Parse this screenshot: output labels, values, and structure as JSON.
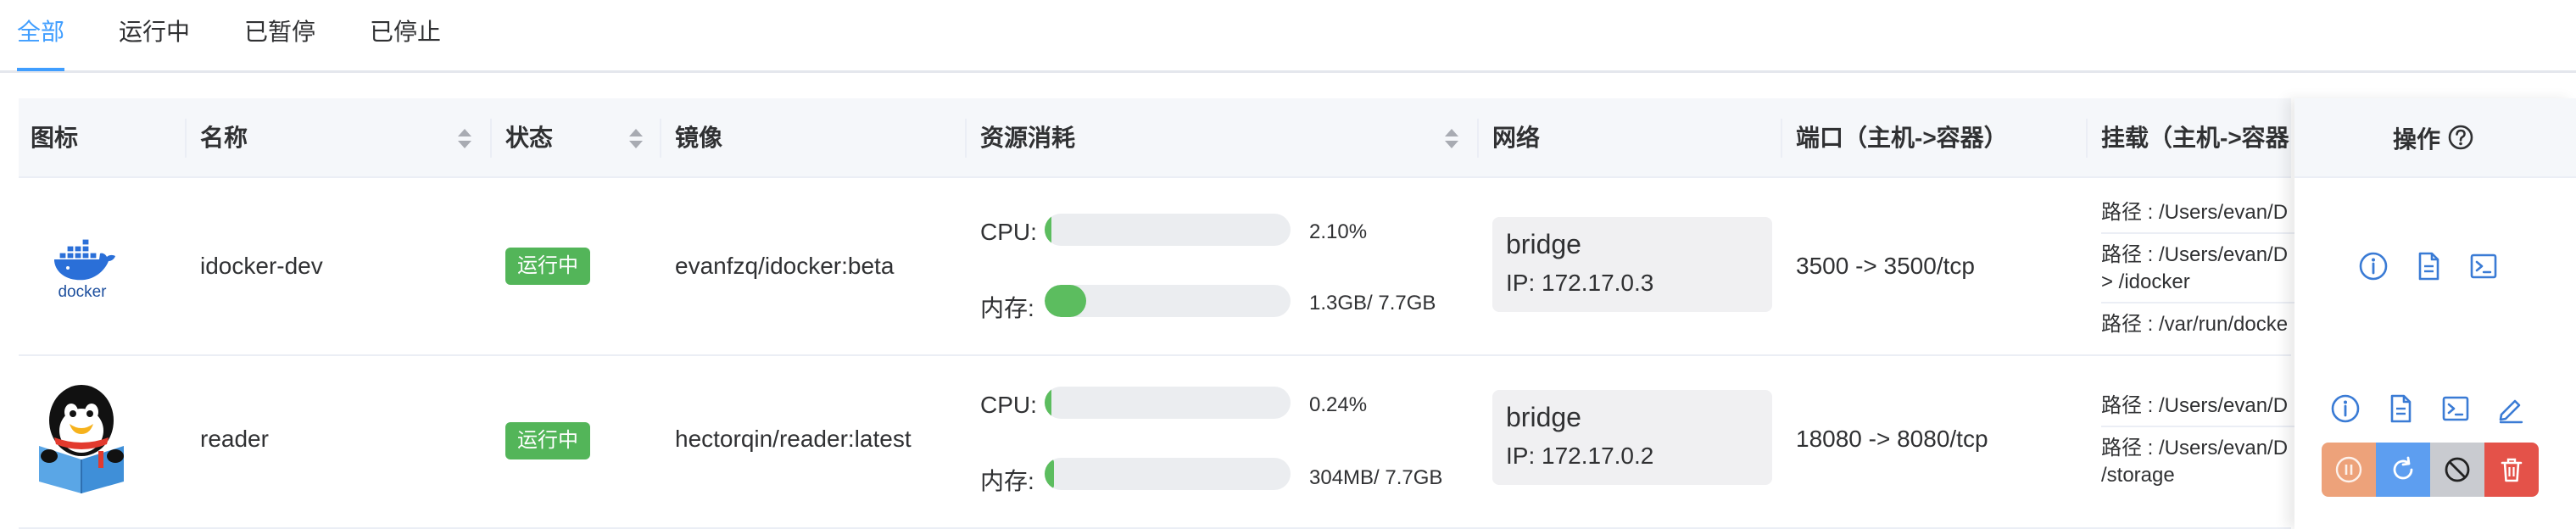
{
  "tabs": [
    {
      "label": "全部",
      "active": true
    },
    {
      "label": "运行中",
      "active": false
    },
    {
      "label": "已暂停",
      "active": false
    },
    {
      "label": "已停止",
      "active": false
    }
  ],
  "columns": {
    "icon": "图标",
    "name": "名称",
    "status": "状态",
    "image": "镜像",
    "resources": "资源消耗",
    "network": "网络",
    "ports": "端口（主机->容器）",
    "mounts": "挂载（主机->容器",
    "actions": "操作"
  },
  "labels": {
    "cpu": "CPU:",
    "mem": "内存:"
  },
  "rows": [
    {
      "icon": "docker-logo",
      "logo_text": "docker",
      "name": "idocker-dev",
      "status": "运行中",
      "image": "evanfzq/idocker:beta",
      "cpu_text": "2.10%",
      "cpu_fraction": 0.021,
      "mem_text": "1.3GB/ 7.7GB",
      "mem_fraction": 0.17,
      "network": {
        "name": "bridge",
        "ip": "IP: 172.17.0.3"
      },
      "ports": "3500 -> 3500/tcp",
      "mounts": [
        "路径 : /Users/evan/D",
        "路径 : /Users/evan/D",
        "> /idocker",
        "路径 : /var/run/docke"
      ]
    },
    {
      "icon": "qq-reader-logo",
      "name": "reader",
      "status": "运行中",
      "image": "hectorqin/reader:latest",
      "cpu_text": "0.24%",
      "cpu_fraction": 0.0024,
      "mem_text": "304MB/ 7.7GB",
      "mem_fraction": 0.039,
      "network": {
        "name": "bridge",
        "ip": "IP: 172.17.0.2"
      },
      "ports": "18080 -> 8080/tcp",
      "mounts": [
        "路径 : /Users/evan/D",
        "路径 : /Users/evan/D",
        "/storage"
      ]
    }
  ],
  "colors": {
    "accent": "#409eff",
    "running_tag": "#53b559",
    "progress": "#5cbd5f",
    "pause_btn": "#eda27a",
    "restart_btn": "#5d9ef0",
    "stop_btn": "#c9cbd0",
    "delete_btn": "#e45249"
  },
  "icons": {
    "help": "question-circle-icon",
    "info": "info-circle-icon",
    "logs": "document-icon",
    "terminal": "terminal-icon",
    "edit": "edit-icon",
    "pause": "pause-icon",
    "restart": "refresh-icon",
    "stop": "ban-icon",
    "delete": "trash-icon"
  }
}
